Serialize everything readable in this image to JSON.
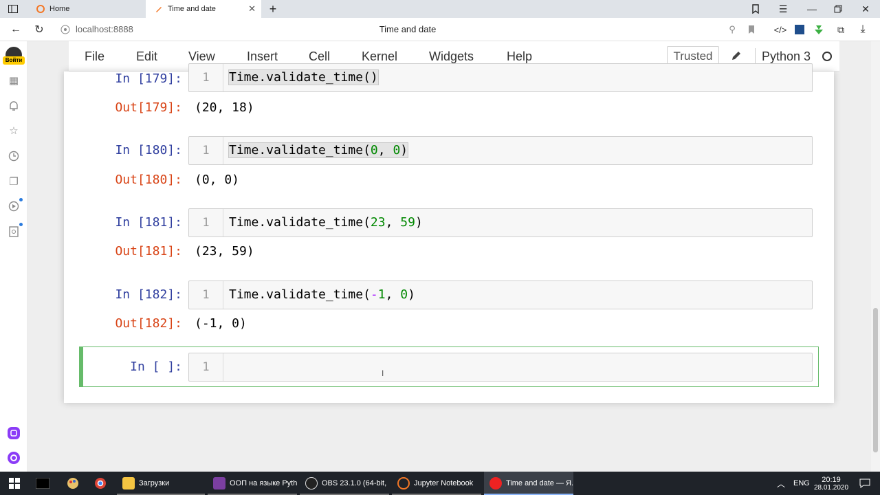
{
  "browser": {
    "tabs": [
      {
        "label": "Home",
        "icon": "jupyter-logo-icon"
      },
      {
        "label": "Time and date",
        "icon": "notebook-icon",
        "active": true
      }
    ],
    "new_tab": "+",
    "address": "localhost:8888",
    "page_title": "Time and date",
    "alice_label": "Войти"
  },
  "jupyter": {
    "menu": [
      "File",
      "Edit",
      "View",
      "Insert",
      "Cell",
      "Kernel",
      "Widgets",
      "Help"
    ],
    "trusted": "Trusted",
    "kernel": "Python 3"
  },
  "cells": [
    {
      "in": "In [179]:",
      "line": "1",
      "code_fn": "Time.validate_time()",
      "out": "Out[179]:",
      "result": "(20, 18)"
    },
    {
      "in": "In [180]:",
      "line": "1",
      "code_fn": "Time.validate_time(",
      "a": "0",
      "sep": ", ",
      "b": "0",
      "close": ")",
      "out": "Out[180]:",
      "result": "(0, 0)"
    },
    {
      "in": "In [181]:",
      "line": "1",
      "code_fn": "Time.validate_time(",
      "a": "23",
      "sep": ", ",
      "b": "59",
      "close": ")",
      "out": "Out[181]:",
      "result": "(23, 59)"
    },
    {
      "in": "In [182]:",
      "line": "1",
      "code_fn": "Time.validate_time(",
      "neg": "-",
      "a": "1",
      "sep": ", ",
      "b": "0",
      "close": ")",
      "out": "Out[182]:",
      "result": "(-1, 0)"
    },
    {
      "in": "In [ ]:",
      "line": "1"
    }
  ],
  "taskbar": {
    "items": [
      {
        "label": "Загрузки"
      },
      {
        "label": "ООП на языке Pyth..."
      },
      {
        "label": "OBS 23.1.0 (64-bit, ..."
      },
      {
        "label": "Jupyter Notebook"
      },
      {
        "label": "Time and date — Я..."
      }
    ],
    "lang": "ENG",
    "time": "20:19",
    "date": "28.01.2020"
  },
  "colors": {
    "accent": "#66bb6a",
    "prompt_in": "#303f9f",
    "prompt_out": "#d84315"
  }
}
